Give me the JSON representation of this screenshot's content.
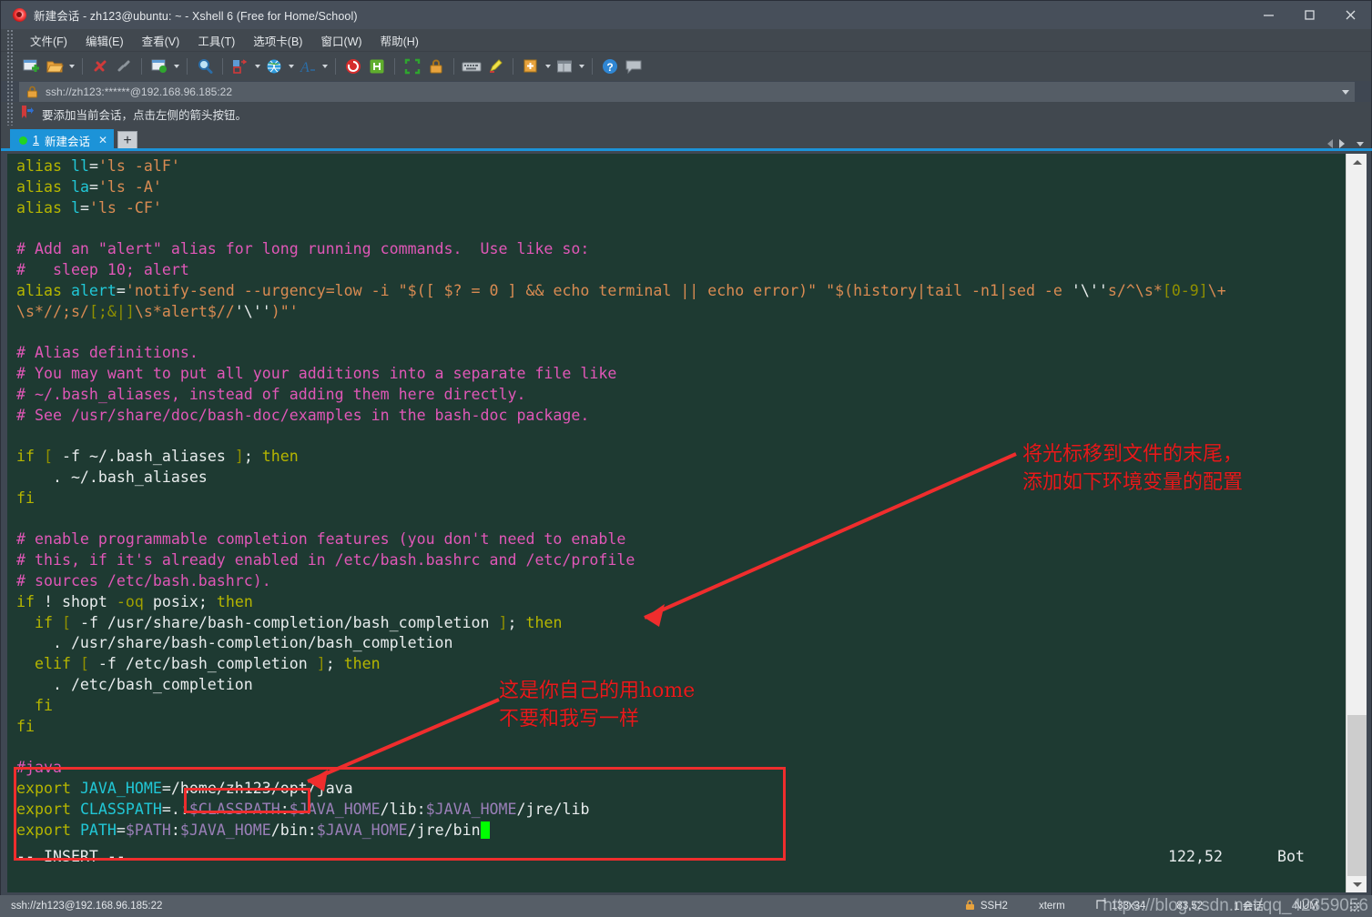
{
  "window": {
    "title": "新建会话 - zh123@ubuntu: ~ - Xshell 6 (Free for Home/School)",
    "logo_icon": "xshell-spiral-logo-icon",
    "minimize_label": "−",
    "maximize_label": "□",
    "close_label": "✕"
  },
  "menubar": {
    "items": [
      {
        "label": "文件(F)",
        "name": "menu-file"
      },
      {
        "label": "编辑(E)",
        "name": "menu-edit"
      },
      {
        "label": "查看(V)",
        "name": "menu-view"
      },
      {
        "label": "工具(T)",
        "name": "menu-tools"
      },
      {
        "label": "选项卡(B)",
        "name": "menu-tabs"
      },
      {
        "label": "窗口(W)",
        "name": "menu-window"
      },
      {
        "label": "帮助(H)",
        "name": "menu-help"
      }
    ]
  },
  "toolbar": {
    "buttons": [
      {
        "name": "new-session-icon",
        "tip": "新建会话"
      },
      {
        "name": "open-folder-icon",
        "tip": "打开"
      },
      {
        "name": "disconnect-icon",
        "tip": "断开"
      },
      {
        "name": "reconnect-icon",
        "tip": "重新连接"
      },
      {
        "name": "file-transfer-icon",
        "tip": "文件传输"
      },
      {
        "name": "find-icon",
        "tip": "查找"
      },
      {
        "name": "layout-icon",
        "tip": "布局"
      },
      {
        "name": "globe-icon",
        "tip": "全局"
      },
      {
        "name": "font-icon",
        "tip": "字体"
      },
      {
        "name": "xshell-icon",
        "tip": "Xshell"
      },
      {
        "name": "xftp-icon",
        "tip": "Xftp"
      },
      {
        "name": "fullscreen-icon",
        "tip": "全屏"
      },
      {
        "name": "lock-icon",
        "tip": "锁定"
      },
      {
        "name": "keyboard-icon",
        "tip": "键盘"
      },
      {
        "name": "highlight-icon",
        "tip": "高亮"
      },
      {
        "name": "add-note-icon",
        "tip": "添加"
      },
      {
        "name": "split-view-icon",
        "tip": "分屏"
      },
      {
        "name": "help-icon",
        "tip": "帮助"
      },
      {
        "name": "chat-icon",
        "tip": "聊天"
      }
    ]
  },
  "address_bar": {
    "lock_icon": "lock-icon",
    "value": "ssh://zh123:******@192.168.96.185:22",
    "dropdown_icon": "chevron-down-icon"
  },
  "hint": {
    "icon": "red-arrow-bookmark-icon",
    "text": "要添加当前会话，点击左侧的箭头按钮。"
  },
  "tabs": {
    "items": [
      {
        "name": "tab-session-1",
        "index": "1",
        "label": "新建会话",
        "status_dot": "connected",
        "close_icon": "close-icon"
      }
    ],
    "new_tab_label": "+",
    "nav_prev_icon": "chevron-left-icon",
    "nav_next_icon": "chevron-right-icon",
    "nav_list_icon": "chevron-down-icon"
  },
  "terminal": {
    "lines": [
      [
        {
          "t": "alias ",
          "c": "yel"
        },
        {
          "t": "ll",
          "c": "cyan"
        },
        {
          "t": "=",
          "c": "wht"
        },
        {
          "t": "'ls -alF'",
          "c": "org"
        }
      ],
      [
        {
          "t": "alias ",
          "c": "yel"
        },
        {
          "t": "la",
          "c": "cyan"
        },
        {
          "t": "=",
          "c": "wht"
        },
        {
          "t": "'ls -A'",
          "c": "org"
        }
      ],
      [
        {
          "t": "alias ",
          "c": "yel"
        },
        {
          "t": "l",
          "c": "cyan"
        },
        {
          "t": "=",
          "c": "wht"
        },
        {
          "t": "'ls -CF'",
          "c": "org"
        }
      ],
      [
        {
          "t": "",
          "c": "wht"
        }
      ],
      [
        {
          "t": "# Add an \"alert\" alias for long running commands.  Use like so:",
          "c": "mag"
        }
      ],
      [
        {
          "t": "#   sleep 10; alert",
          "c": "mag"
        }
      ],
      [
        {
          "t": "alias ",
          "c": "yel"
        },
        {
          "t": "alert",
          "c": "cyan"
        },
        {
          "t": "=",
          "c": "wht"
        },
        {
          "t": "'notify-send --urgency=low -i \"$([ $? = 0 ] && echo terminal || echo error)\" \"$(history|tail -n1|sed -e ",
          "c": "org"
        },
        {
          "t": "'\\''",
          "c": "wht"
        },
        {
          "t": "s/^\\s*",
          "c": "org"
        },
        {
          "t": "[0-9]",
          "c": "oliv"
        },
        {
          "t": "\\+",
          "c": "org"
        }
      ],
      [
        {
          "t": "\\s*//;s/",
          "c": "org"
        },
        {
          "t": "[;&|]",
          "c": "oliv"
        },
        {
          "t": "\\s*alert$//",
          "c": "org"
        },
        {
          "t": "'\\''",
          "c": "wht"
        },
        {
          "t": ")\"'",
          "c": "org"
        }
      ],
      [
        {
          "t": "",
          "c": "wht"
        }
      ],
      [
        {
          "t": "# Alias definitions.",
          "c": "mag"
        }
      ],
      [
        {
          "t": "# You may want to put all your additions into a separate file like",
          "c": "mag"
        }
      ],
      [
        {
          "t": "# ~/.bash_aliases, instead of adding them here directly.",
          "c": "mag"
        }
      ],
      [
        {
          "t": "# See /usr/share/doc/bash-doc/examples in the bash-doc package.",
          "c": "mag"
        }
      ],
      [
        {
          "t": "",
          "c": "wht"
        }
      ],
      [
        {
          "t": "if ",
          "c": "yel"
        },
        {
          "t": "[",
          "c": "oliv"
        },
        {
          "t": " -f ",
          "c": "wht"
        },
        {
          "t": "~/.bash_aliases",
          "c": "wht"
        },
        {
          "t": " ",
          "c": "wht"
        },
        {
          "t": "]",
          "c": "oliv"
        },
        {
          "t": "; ",
          "c": "wht"
        },
        {
          "t": "then",
          "c": "yel"
        }
      ],
      [
        {
          "t": "    . ~/.bash_aliases",
          "c": "wht"
        }
      ],
      [
        {
          "t": "fi",
          "c": "yel"
        }
      ],
      [
        {
          "t": "",
          "c": "wht"
        }
      ],
      [
        {
          "t": "# enable programmable completion features (you don't need to enable",
          "c": "mag"
        }
      ],
      [
        {
          "t": "# this, if it's already enabled in /etc/bash.bashrc and /etc/profile",
          "c": "mag"
        }
      ],
      [
        {
          "t": "# sources /etc/bash.bashrc).",
          "c": "mag"
        }
      ],
      [
        {
          "t": "if ",
          "c": "yel"
        },
        {
          "t": "! shopt ",
          "c": "wht"
        },
        {
          "t": "-oq",
          "c": "dyel"
        },
        {
          "t": " posix",
          "c": "wht"
        },
        {
          "t": "; ",
          "c": "wht"
        },
        {
          "t": "then",
          "c": "yel"
        }
      ],
      [
        {
          "t": "  ",
          "c": "wht"
        },
        {
          "t": "if ",
          "c": "yel"
        },
        {
          "t": "[",
          "c": "oliv"
        },
        {
          "t": " -f /usr/share/bash-completion/bash_completion ",
          "c": "wht"
        },
        {
          "t": "]",
          "c": "oliv"
        },
        {
          "t": "; ",
          "c": "wht"
        },
        {
          "t": "then",
          "c": "yel"
        }
      ],
      [
        {
          "t": "    . /usr/share/bash-completion/bash_completion",
          "c": "wht"
        }
      ],
      [
        {
          "t": "  ",
          "c": "wht"
        },
        {
          "t": "elif ",
          "c": "yel"
        },
        {
          "t": "[",
          "c": "oliv"
        },
        {
          "t": " -f /etc/bash_completion ",
          "c": "wht"
        },
        {
          "t": "]",
          "c": "oliv"
        },
        {
          "t": "; ",
          "c": "wht"
        },
        {
          "t": "then",
          "c": "yel"
        }
      ],
      [
        {
          "t": "    . /etc/bash_completion",
          "c": "wht"
        }
      ],
      [
        {
          "t": "  ",
          "c": "wht"
        },
        {
          "t": "fi",
          "c": "yel"
        }
      ],
      [
        {
          "t": "fi",
          "c": "yel"
        }
      ],
      [
        {
          "t": "",
          "c": "wht"
        }
      ],
      [
        {
          "t": "#java",
          "c": "mag"
        }
      ],
      [
        {
          "t": "export ",
          "c": "yel"
        },
        {
          "t": "JAVA_HOME",
          "c": "cyan"
        },
        {
          "t": "=",
          "c": "wht"
        },
        {
          "t": "/home/zh123/opt/java",
          "c": "wht"
        }
      ],
      [
        {
          "t": "export ",
          "c": "yel"
        },
        {
          "t": "CLASSPATH",
          "c": "cyan"
        },
        {
          "t": "=",
          "c": "wht"
        },
        {
          "t": ".:",
          "c": "wht"
        },
        {
          "t": "$CLASSPATH",
          "c": "pur"
        },
        {
          "t": ":",
          "c": "wht"
        },
        {
          "t": "$JAVA_HOME",
          "c": "pur"
        },
        {
          "t": "/lib",
          "c": "wht"
        },
        {
          "t": ":",
          "c": "wht"
        },
        {
          "t": "$JAVA_HOME",
          "c": "pur"
        },
        {
          "t": "/jre/lib",
          "c": "wht"
        }
      ],
      [
        {
          "t": "export ",
          "c": "yel"
        },
        {
          "t": "PATH",
          "c": "cyan"
        },
        {
          "t": "=",
          "c": "wht"
        },
        {
          "t": "$PATH",
          "c": "pur"
        },
        {
          "t": ":",
          "c": "wht"
        },
        {
          "t": "$JAVA_HOME",
          "c": "pur"
        },
        {
          "t": "/bin",
          "c": "wht"
        },
        {
          "t": ":",
          "c": "wht"
        },
        {
          "t": "$JAVA_HOME",
          "c": "pur"
        },
        {
          "t": "/jre/bin",
          "c": "wht"
        },
        {
          "t": " ",
          "c": "cursor"
        }
      ]
    ],
    "status": {
      "mode": "-- INSERT --",
      "position": "122,52",
      "scroll": "Bot"
    },
    "scrollbar": {
      "up_icon": "chevron-up-icon",
      "down_icon": "chevron-down-icon"
    }
  },
  "annotations": {
    "note_top": "将光标移到文件的末尾，\n添加如下环境变量的配置",
    "note_mid": "这是你自己的用home\n不要和我写一样",
    "color": "#e8191b"
  },
  "statusbar": {
    "connection": "ssh://zh123@192.168.96.185:22",
    "security_icon": "lock-icon",
    "protocol": "SSH2",
    "emulation": "xterm",
    "size_icon": "resize-icon",
    "size": "133x34",
    "cursor_pos": "83,52",
    "session_count": "1 会话",
    "cap_indicator": "NUM",
    "resize_grip_icon": "resize-grip-icon"
  },
  "watermark": {
    "text": "https://blog.csdn.net/qq_42359056"
  }
}
